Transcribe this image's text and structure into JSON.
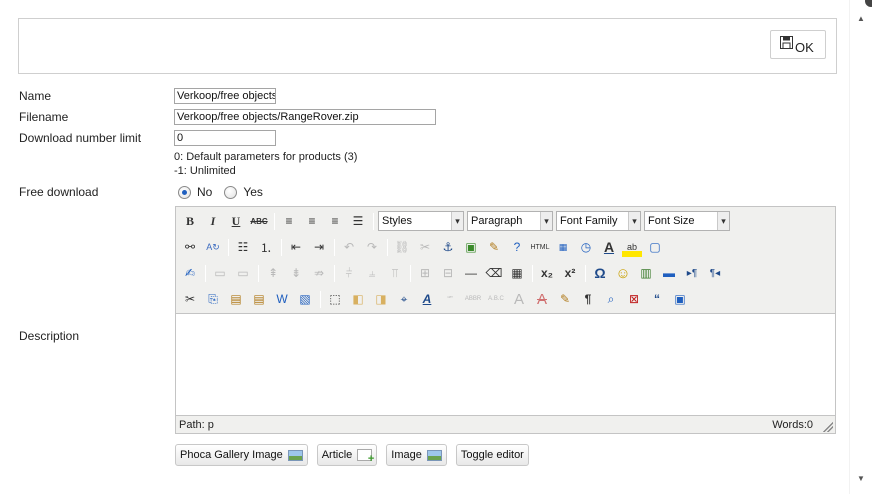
{
  "toolbar": {
    "ok_label": "OK"
  },
  "form": {
    "name_label": "Name",
    "name_value": "Verkoop/free objects.",
    "filename_label": "Filename",
    "filename_value": "Verkoop/free objects/RangeRover.zip",
    "limit_label": "Download number limit",
    "limit_value": "0",
    "limit_hint_1": "0: Default parameters for products (3)",
    "limit_hint_2": "-1: Unlimited",
    "free_label": "Free download",
    "free_no": "No",
    "free_yes": "Yes",
    "free_selected": "No",
    "description_label": "Description"
  },
  "editor": {
    "styles": "Styles",
    "format": "Paragraph",
    "font_family": "Font Family",
    "font_size": "Font Size",
    "path": "Path: p",
    "words": "Words:0"
  },
  "buttons": {
    "phoca": "Phoca Gallery Image",
    "article": "Article",
    "image": "Image",
    "toggle": "Toggle editor"
  },
  "colors": {
    "accent": "#1f5fbf",
    "border": "#cfcfcf",
    "editor_bg": "#f0f0ee"
  }
}
